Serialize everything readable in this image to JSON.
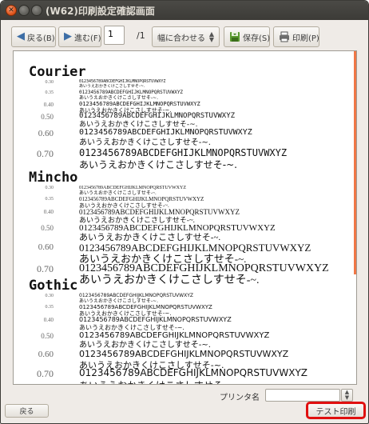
{
  "window": {
    "title": "(W62)印刷設定確認画面"
  },
  "toolbar": {
    "back_label": "戻る(B)",
    "forward_label": "進む(F)",
    "page_value": "1",
    "page_total": "/1",
    "zoom_selected": "幅に合わせる",
    "save_label": "保存(S)",
    "print_label": "印刷(P)"
  },
  "preview": {
    "ascii_sample": "0123456789ABCDEFGHIJKLMNOPQRSTUVWXYZ",
    "kana_sample": "あいうえおかきくけこさしすせそ-~.",
    "sections": [
      {
        "name": "Courier",
        "rows": [
          "0.30",
          "0.35",
          "0.40",
          "0.50",
          "0.60",
          "0.70"
        ]
      },
      {
        "name": "Mincho",
        "rows": [
          "0.30",
          "0.35",
          "0.40",
          "0.50",
          "0.60",
          "0.70"
        ]
      },
      {
        "name": "Gothic",
        "rows": [
          "0.30",
          "0.35",
          "0.40",
          "0.50",
          "0.60",
          "0.70"
        ]
      }
    ]
  },
  "bottom": {
    "printer_label": "プリンタ名",
    "printer_value": "",
    "back_label": "戻る",
    "test_print_label": "テスト印刷"
  },
  "colors": {
    "titlebar": "#3c3b37",
    "scroll_accent": "#f07746",
    "highlight": "#e01010"
  }
}
